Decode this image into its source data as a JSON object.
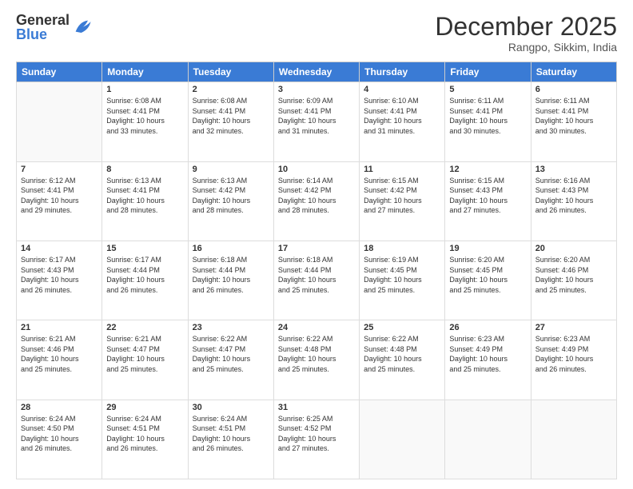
{
  "logo": {
    "general": "General",
    "blue": "Blue"
  },
  "header": {
    "month": "December 2025",
    "location": "Rangpo, Sikkim, India"
  },
  "days": [
    "Sunday",
    "Monday",
    "Tuesday",
    "Wednesday",
    "Thursday",
    "Friday",
    "Saturday"
  ],
  "weeks": [
    [
      {
        "num": "",
        "info": ""
      },
      {
        "num": "1",
        "info": "Sunrise: 6:08 AM\nSunset: 4:41 PM\nDaylight: 10 hours\nand 33 minutes."
      },
      {
        "num": "2",
        "info": "Sunrise: 6:08 AM\nSunset: 4:41 PM\nDaylight: 10 hours\nand 32 minutes."
      },
      {
        "num": "3",
        "info": "Sunrise: 6:09 AM\nSunset: 4:41 PM\nDaylight: 10 hours\nand 31 minutes."
      },
      {
        "num": "4",
        "info": "Sunrise: 6:10 AM\nSunset: 4:41 PM\nDaylight: 10 hours\nand 31 minutes."
      },
      {
        "num": "5",
        "info": "Sunrise: 6:11 AM\nSunset: 4:41 PM\nDaylight: 10 hours\nand 30 minutes."
      },
      {
        "num": "6",
        "info": "Sunrise: 6:11 AM\nSunset: 4:41 PM\nDaylight: 10 hours\nand 30 minutes."
      }
    ],
    [
      {
        "num": "7",
        "info": "Sunrise: 6:12 AM\nSunset: 4:41 PM\nDaylight: 10 hours\nand 29 minutes."
      },
      {
        "num": "8",
        "info": "Sunrise: 6:13 AM\nSunset: 4:41 PM\nDaylight: 10 hours\nand 28 minutes."
      },
      {
        "num": "9",
        "info": "Sunrise: 6:13 AM\nSunset: 4:42 PM\nDaylight: 10 hours\nand 28 minutes."
      },
      {
        "num": "10",
        "info": "Sunrise: 6:14 AM\nSunset: 4:42 PM\nDaylight: 10 hours\nand 28 minutes."
      },
      {
        "num": "11",
        "info": "Sunrise: 6:15 AM\nSunset: 4:42 PM\nDaylight: 10 hours\nand 27 minutes."
      },
      {
        "num": "12",
        "info": "Sunrise: 6:15 AM\nSunset: 4:43 PM\nDaylight: 10 hours\nand 27 minutes."
      },
      {
        "num": "13",
        "info": "Sunrise: 6:16 AM\nSunset: 4:43 PM\nDaylight: 10 hours\nand 26 minutes."
      }
    ],
    [
      {
        "num": "14",
        "info": "Sunrise: 6:17 AM\nSunset: 4:43 PM\nDaylight: 10 hours\nand 26 minutes."
      },
      {
        "num": "15",
        "info": "Sunrise: 6:17 AM\nSunset: 4:44 PM\nDaylight: 10 hours\nand 26 minutes."
      },
      {
        "num": "16",
        "info": "Sunrise: 6:18 AM\nSunset: 4:44 PM\nDaylight: 10 hours\nand 26 minutes."
      },
      {
        "num": "17",
        "info": "Sunrise: 6:18 AM\nSunset: 4:44 PM\nDaylight: 10 hours\nand 25 minutes."
      },
      {
        "num": "18",
        "info": "Sunrise: 6:19 AM\nSunset: 4:45 PM\nDaylight: 10 hours\nand 25 minutes."
      },
      {
        "num": "19",
        "info": "Sunrise: 6:20 AM\nSunset: 4:45 PM\nDaylight: 10 hours\nand 25 minutes."
      },
      {
        "num": "20",
        "info": "Sunrise: 6:20 AM\nSunset: 4:46 PM\nDaylight: 10 hours\nand 25 minutes."
      }
    ],
    [
      {
        "num": "21",
        "info": "Sunrise: 6:21 AM\nSunset: 4:46 PM\nDaylight: 10 hours\nand 25 minutes."
      },
      {
        "num": "22",
        "info": "Sunrise: 6:21 AM\nSunset: 4:47 PM\nDaylight: 10 hours\nand 25 minutes."
      },
      {
        "num": "23",
        "info": "Sunrise: 6:22 AM\nSunset: 4:47 PM\nDaylight: 10 hours\nand 25 minutes."
      },
      {
        "num": "24",
        "info": "Sunrise: 6:22 AM\nSunset: 4:48 PM\nDaylight: 10 hours\nand 25 minutes."
      },
      {
        "num": "25",
        "info": "Sunrise: 6:22 AM\nSunset: 4:48 PM\nDaylight: 10 hours\nand 25 minutes."
      },
      {
        "num": "26",
        "info": "Sunrise: 6:23 AM\nSunset: 4:49 PM\nDaylight: 10 hours\nand 25 minutes."
      },
      {
        "num": "27",
        "info": "Sunrise: 6:23 AM\nSunset: 4:49 PM\nDaylight: 10 hours\nand 26 minutes."
      }
    ],
    [
      {
        "num": "28",
        "info": "Sunrise: 6:24 AM\nSunset: 4:50 PM\nDaylight: 10 hours\nand 26 minutes."
      },
      {
        "num": "29",
        "info": "Sunrise: 6:24 AM\nSunset: 4:51 PM\nDaylight: 10 hours\nand 26 minutes."
      },
      {
        "num": "30",
        "info": "Sunrise: 6:24 AM\nSunset: 4:51 PM\nDaylight: 10 hours\nand 26 minutes."
      },
      {
        "num": "31",
        "info": "Sunrise: 6:25 AM\nSunset: 4:52 PM\nDaylight: 10 hours\nand 27 minutes."
      },
      {
        "num": "",
        "info": ""
      },
      {
        "num": "",
        "info": ""
      },
      {
        "num": "",
        "info": ""
      }
    ]
  ]
}
